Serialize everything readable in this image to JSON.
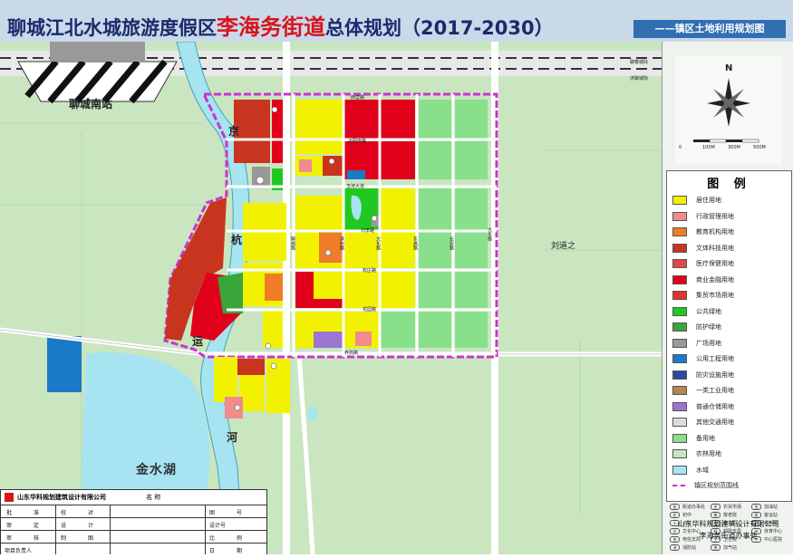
{
  "header": {
    "title_prefix": "聊城江北水城旅游度假区",
    "title_highlight": "李海务街道",
    "title_suffix": "总体规划（2017-2030）",
    "subtitle": "——镇区土地利用规划图"
  },
  "map": {
    "labels": {
      "station": "聊城南站",
      "lake": "金水湖",
      "village": "刘道之",
      "canal_1": "京",
      "canal_2": "杭",
      "canal_3": "运",
      "canal_4": "河",
      "rail_1": "聊泰城际",
      "rail_2": "济聊城际"
    },
    "roads": {
      "r1": "西营路",
      "r2": "运明南路",
      "r3": "玉液大道",
      "r4": "刘李路",
      "r5": "权庄路",
      "r6": "花园路",
      "r7": "养驹路",
      "r8": "聊城路",
      "r9": "滨州路",
      "r10": "文化路",
      "r11": "东昌路",
      "r12": "长安路",
      "r13": "大东路"
    }
  },
  "compass": {
    "north": "N",
    "scale": [
      "0",
      "100M",
      "300M",
      "500M"
    ]
  },
  "legend": {
    "title": "图 例",
    "items": [
      {
        "label": "居住用地",
        "color": "#f2f200"
      },
      {
        "label": "行政管理用地",
        "color": "#f08c8c"
      },
      {
        "label": "教育机构用地",
        "color": "#f07c2a"
      },
      {
        "label": "文体科技用地",
        "color": "#c8341e"
      },
      {
        "label": "医疗保健用地",
        "color": "#e04a4a"
      },
      {
        "label": "商业金融用地",
        "color": "#e0001a"
      },
      {
        "label": "集贸市场用地",
        "color": "#e2342a"
      },
      {
        "label": "公共绿地",
        "color": "#22c822"
      },
      {
        "label": "防护绿地",
        "color": "#3aa63a"
      },
      {
        "label": "广场用地",
        "color": "#999999"
      },
      {
        "label": "公用工程用地",
        "color": "#1a7ac8"
      },
      {
        "label": "防灾设施用地",
        "color": "#2a4aa0"
      },
      {
        "label": "一类工业用地",
        "color": "#b8864a"
      },
      {
        "label": "普通仓储用地",
        "color": "#9a76d0"
      },
      {
        "label": "其他交通用地",
        "color": "#dcdcdc"
      },
      {
        "label": "备用地",
        "color": "#88e08a"
      },
      {
        "label": "农林用地",
        "color": "#c9e6c0"
      },
      {
        "label": "水域",
        "color": "#a6e4f2"
      },
      {
        "label": "镇区规划范围线",
        "color": "#cc33cc"
      }
    ]
  },
  "symbols": [
    {
      "code": "街",
      "label": "街道办事处"
    },
    {
      "code": "农",
      "label": "农贸市场"
    },
    {
      "code": "加",
      "label": "加油站"
    },
    {
      "code": "初",
      "label": "初中"
    },
    {
      "code": "敬",
      "label": "敬老院"
    },
    {
      "code": "客",
      "label": "客运站"
    },
    {
      "code": "小",
      "label": "小学"
    },
    {
      "code": "幼",
      "label": "幼儿园"
    },
    {
      "code": "供",
      "label": "供电站"
    },
    {
      "code": "文",
      "label": "文化中心"
    },
    {
      "code": "邮",
      "label": "邮政支局"
    },
    {
      "code": "体",
      "label": "体育中心"
    },
    {
      "code": "电",
      "label": "电信支局"
    },
    {
      "code": "卫",
      "label": "卫生院"
    },
    {
      "code": "中",
      "label": "中心医院"
    },
    {
      "code": "消",
      "label": "消防站"
    },
    {
      "code": "燃",
      "label": "加气站"
    }
  ],
  "company": {
    "line1": "山东华科规划建筑设计有限公司",
    "line2": "李海务街道办事处"
  },
  "title_block": {
    "company": "山东华科规划建筑设计有限公司",
    "name_label": "名 称",
    "rows": [
      [
        "批",
        "准",
        "校",
        "对",
        "图",
        "号"
      ],
      [
        "审",
        "定",
        "设",
        "计",
        "设计号",
        ""
      ],
      [
        "审",
        "核",
        "制",
        "图",
        "比",
        "例"
      ],
      [
        "项目负责人",
        "",
        "",
        "",
        "日",
        "期"
      ]
    ]
  }
}
